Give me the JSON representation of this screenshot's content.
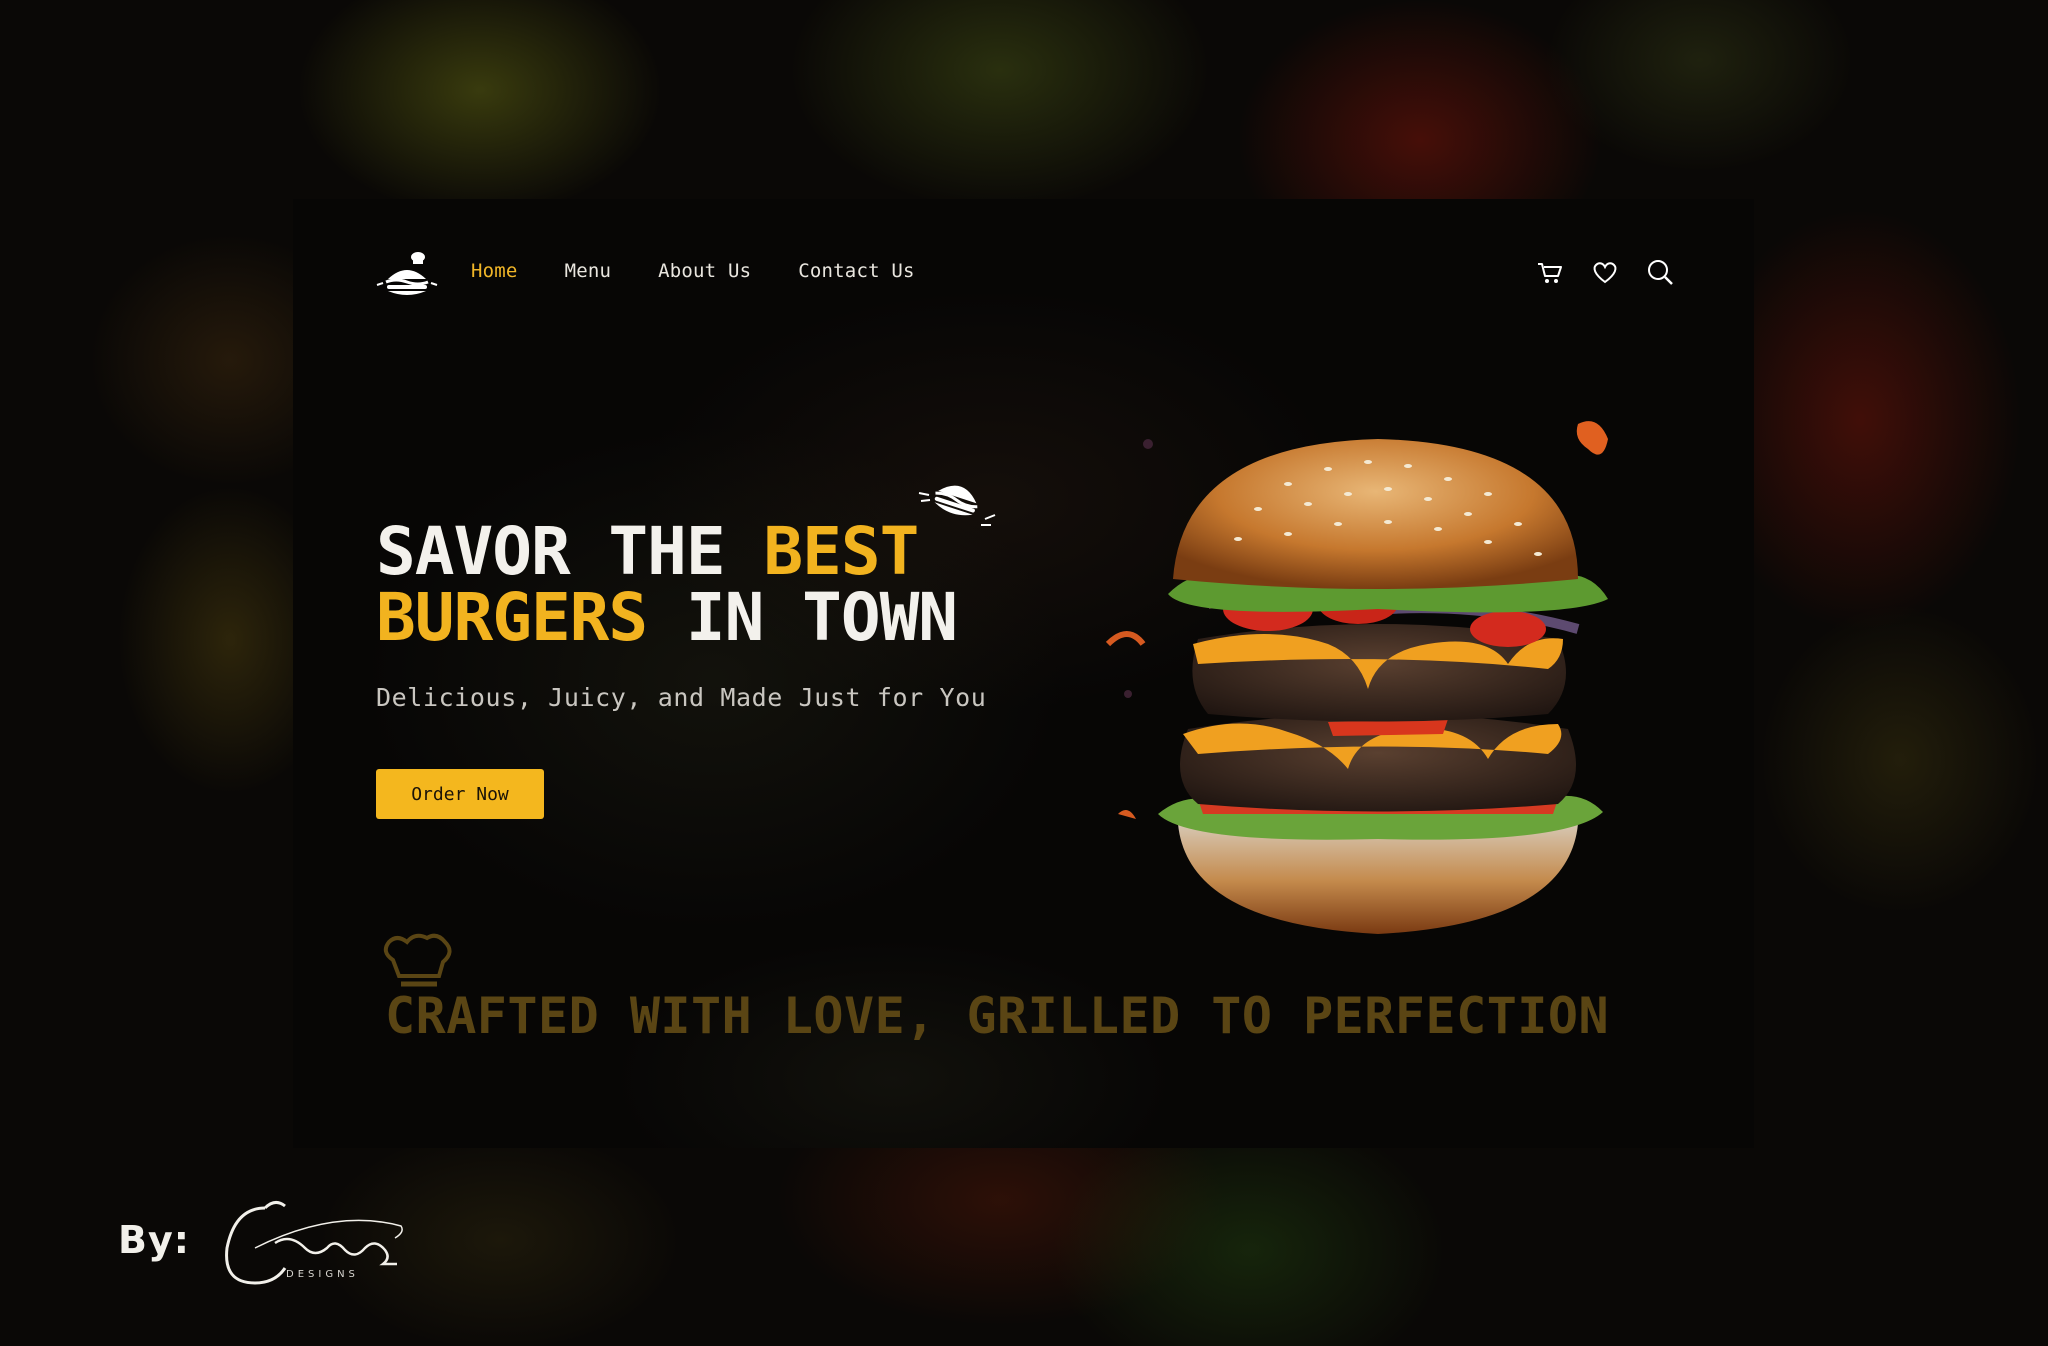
{
  "nav": {
    "items": [
      {
        "label": "Home",
        "active": true
      },
      {
        "label": "Menu",
        "active": false
      },
      {
        "label": "About Us",
        "active": false
      },
      {
        "label": "Contact Us",
        "active": false
      }
    ],
    "icons": [
      "cart-icon",
      "heart-icon",
      "search-icon"
    ]
  },
  "hero": {
    "headline_line1_white": "SAVOR THE ",
    "headline_line1_accent": "BEST",
    "headline_line2_accent": "BURGERS",
    "headline_line2_white": " IN TOWN",
    "subtitle": "Delicious, Juicy, and Made Just for You",
    "cta_label": "Order Now"
  },
  "tagline": "CRAFTED WITH LOVE, GRILLED TO PERFECTION",
  "credit": {
    "by": "By:",
    "brand": "Crownz",
    "sub": "DESIGNS"
  },
  "colors": {
    "accent": "#f2b31f",
    "background": "#070605",
    "text": "#f3f1ec",
    "tagline": "#5a4514"
  }
}
